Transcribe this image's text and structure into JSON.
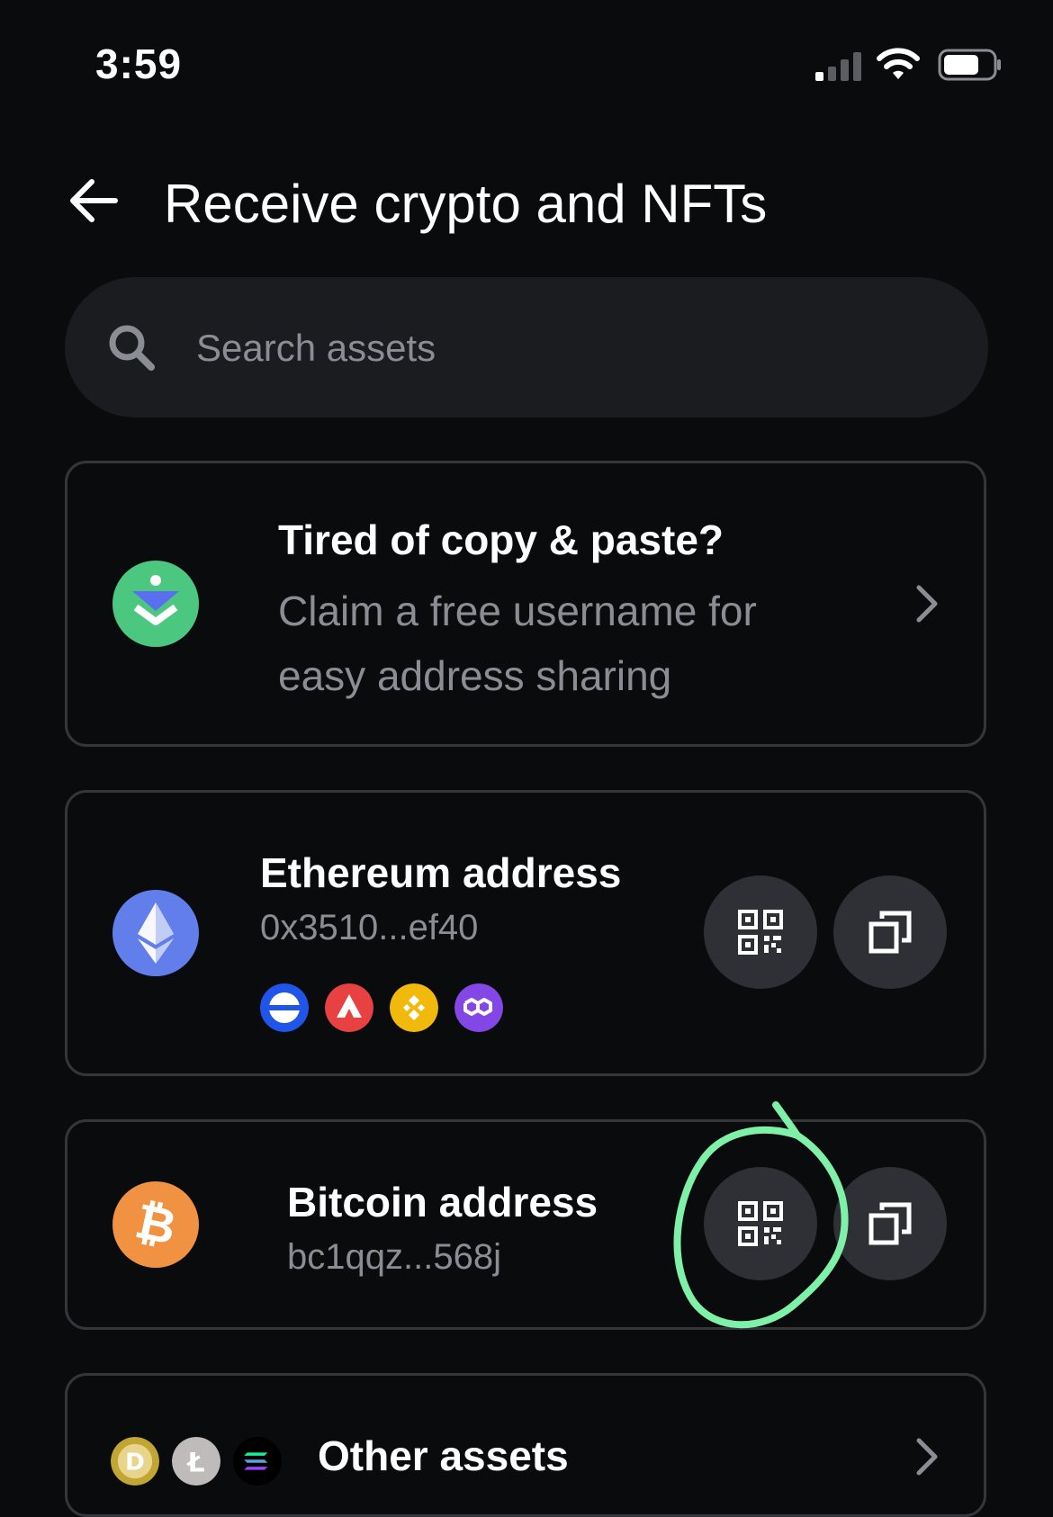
{
  "status_bar": {
    "time": "3:59"
  },
  "header": {
    "title": "Receive crypto and NFTs"
  },
  "search": {
    "placeholder": "Search assets"
  },
  "promo": {
    "title": "Tired of copy & paste?",
    "description": "Claim a free username for easy address sharing"
  },
  "ethereum": {
    "name": "Ethereum address",
    "address": "0x3510...ef40",
    "networks": [
      "base-icon",
      "avalanche-icon",
      "bnb-icon",
      "polygon-icon"
    ]
  },
  "bitcoin": {
    "name": "Bitcoin address",
    "address": "bc1qqz...568j"
  },
  "other": {
    "title": "Other assets"
  },
  "colors": {
    "background": "#0a0b0d",
    "card_border": "#34363c",
    "button_bg": "#2e3036",
    "muted_text": "#8a8d94",
    "ethereum": "#627eea",
    "bitcoin": "#f09242",
    "annotation": "#7ef0a8"
  }
}
